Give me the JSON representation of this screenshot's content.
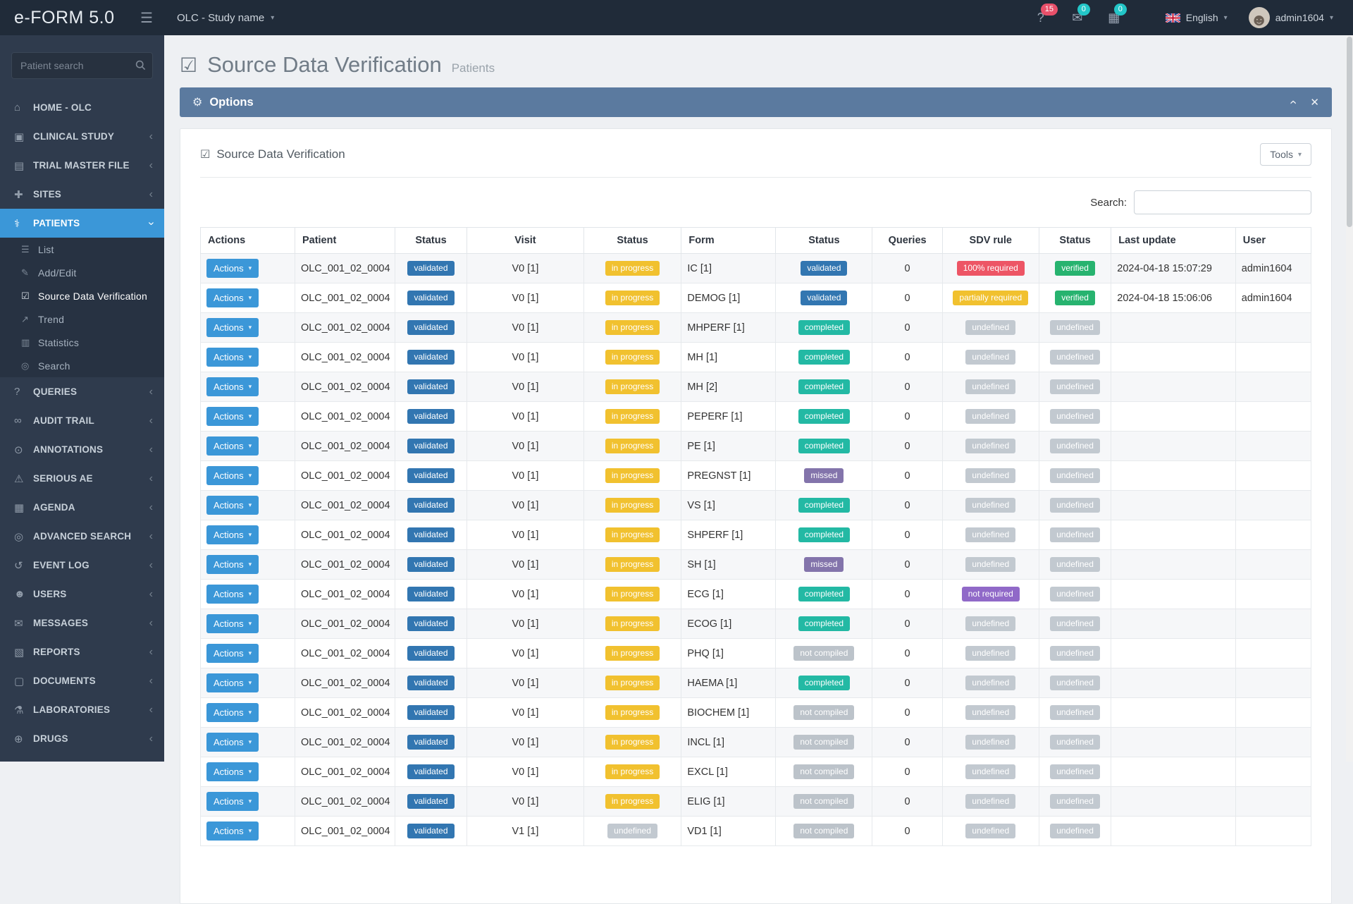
{
  "topbar": {
    "logo": "e-FORM 5.0",
    "study": "OLC - Study name",
    "language": "English",
    "username": "admin1604",
    "notifications": [
      {
        "icon": "?",
        "icon_name": "help-icon",
        "count": "15",
        "badge_style": "red"
      },
      {
        "icon": "✉",
        "icon_name": "messages-icon",
        "count": "0",
        "badge_style": "teal"
      },
      {
        "icon": "▦",
        "icon_name": "calendar-icon",
        "count": "0",
        "badge_style": "teal"
      }
    ]
  },
  "sidebar": {
    "search_placeholder": "Patient search",
    "items": [
      {
        "label": "HOME - OLC",
        "icon": "⌂",
        "icon_name": "home-icon",
        "name": "sidebar-item-home-olc",
        "chev": "none"
      },
      {
        "label": "CLINICAL STUDY",
        "icon": "▣",
        "icon_name": "clinical-study-icon",
        "name": "sidebar-item-clinical-study",
        "chev": "left"
      },
      {
        "label": "TRIAL MASTER FILE",
        "icon": "▤",
        "icon_name": "folder-icon",
        "name": "sidebar-item-trial-master-file",
        "chev": "left"
      },
      {
        "label": "SITES",
        "icon": "✚",
        "icon_name": "hospital-icon",
        "name": "sidebar-item-sites",
        "chev": "left"
      },
      {
        "label": "PATIENTS",
        "icon": "⚕",
        "icon_name": "patients-icon",
        "name": "sidebar-item-patients",
        "chev": "down",
        "state": "active",
        "sub": [
          {
            "label": "List",
            "icon": "☰",
            "icon_name": "list-icon",
            "name": "sidebar-subitem-list"
          },
          {
            "label": "Add/Edit",
            "icon": "✎",
            "icon_name": "pencil-icon",
            "name": "sidebar-subitem-add-edit"
          },
          {
            "label": "Source Data Verification",
            "icon": "☑",
            "icon_name": "check-square-icon",
            "name": "sidebar-subitem-source-data-verification",
            "state": "active"
          },
          {
            "label": "Trend",
            "icon": "↗",
            "icon_name": "trend-icon",
            "name": "sidebar-subitem-trend"
          },
          {
            "label": "Statistics",
            "icon": "▥",
            "icon_name": "bar-chart-icon",
            "name": "sidebar-subitem-statistics"
          },
          {
            "label": "Search",
            "icon": "◎",
            "icon_name": "search-icon",
            "name": "sidebar-subitem-search"
          }
        ]
      },
      {
        "label": "QUERIES",
        "icon": "?",
        "icon_name": "question-icon",
        "name": "sidebar-item-queries",
        "chev": "left"
      },
      {
        "label": "AUDIT TRAIL",
        "icon": "∞",
        "icon_name": "link-icon",
        "name": "sidebar-item-audit-trail",
        "chev": "left"
      },
      {
        "label": "ANNOTATIONS",
        "icon": "⊙",
        "icon_name": "comment-icon",
        "name": "sidebar-item-annotations",
        "chev": "left"
      },
      {
        "label": "SERIOUS AE",
        "icon": "⚠",
        "icon_name": "warning-icon",
        "name": "sidebar-item-serious-ae",
        "chev": "left"
      },
      {
        "label": "AGENDA",
        "icon": "▦",
        "icon_name": "calendar-icon",
        "name": "sidebar-item-agenda",
        "chev": "left"
      },
      {
        "label": "ADVANCED SEARCH",
        "icon": "◎",
        "icon_name": "search-icon",
        "name": "sidebar-item-advanced-search",
        "chev": "left"
      },
      {
        "label": "EVENT LOG",
        "icon": "↺",
        "icon_name": "history-icon",
        "name": "sidebar-item-event-log",
        "chev": "left"
      },
      {
        "label": "USERS",
        "icon": "☻",
        "icon_name": "user-icon",
        "name": "sidebar-item-users",
        "chev": "left"
      },
      {
        "label": "MESSAGES",
        "icon": "✉",
        "icon_name": "envelope-icon",
        "name": "sidebar-item-messages",
        "chev": "left"
      },
      {
        "label": "REPORTS",
        "icon": "▧",
        "icon_name": "report-icon",
        "name": "sidebar-item-reports",
        "chev": "left"
      },
      {
        "label": "DOCUMENTS",
        "icon": "▢",
        "icon_name": "document-icon",
        "name": "sidebar-item-documents",
        "chev": "left"
      },
      {
        "label": "LABORATORIES",
        "icon": "⚗",
        "icon_name": "flask-icon",
        "name": "sidebar-item-laboratories",
        "chev": "left"
      },
      {
        "label": "DRUGS",
        "icon": "⊕",
        "icon_name": "pills-icon",
        "name": "sidebar-item-drugs",
        "chev": "left"
      }
    ]
  },
  "page": {
    "title": "Source Data Verification",
    "subtitle": "Patients",
    "options_label": "Options"
  },
  "panel": {
    "title": "Source Data Verification",
    "tools_label": "Tools",
    "search_label": "Search:"
  },
  "table": {
    "actions_label": "Actions",
    "headers": [
      "Actions",
      "Patient",
      "Status",
      "Visit",
      "Status",
      "Form",
      "Status",
      "Queries",
      "SDV rule",
      "Status",
      "Last update",
      "User"
    ],
    "rows": [
      {
        "patient": "OLC_001_02_0004",
        "patient_status": "validated",
        "visit": "V0 [1]",
        "visit_status": "in progress",
        "form": "IC [1]",
        "form_status": "validated",
        "queries": "0",
        "sdv_rule": "100% required",
        "sdv_status": "verified",
        "last_update": "2024-04-18 15:07:29",
        "user": "admin1604"
      },
      {
        "patient": "OLC_001_02_0004",
        "patient_status": "validated",
        "visit": "V0 [1]",
        "visit_status": "in progress",
        "form": "DEMOG [1]",
        "form_status": "validated",
        "queries": "0",
        "sdv_rule": "partially required",
        "sdv_status": "verified",
        "last_update": "2024-04-18 15:06:06",
        "user": "admin1604"
      },
      {
        "patient": "OLC_001_02_0004",
        "patient_status": "validated",
        "visit": "V0 [1]",
        "visit_status": "in progress",
        "form": "MHPERF [1]",
        "form_status": "completed",
        "queries": "0",
        "sdv_rule": "undefined",
        "sdv_status": "undefined",
        "last_update": "",
        "user": ""
      },
      {
        "patient": "OLC_001_02_0004",
        "patient_status": "validated",
        "visit": "V0 [1]",
        "visit_status": "in progress",
        "form": "MH [1]",
        "form_status": "completed",
        "queries": "0",
        "sdv_rule": "undefined",
        "sdv_status": "undefined",
        "last_update": "",
        "user": ""
      },
      {
        "patient": "OLC_001_02_0004",
        "patient_status": "validated",
        "visit": "V0 [1]",
        "visit_status": "in progress",
        "form": "MH [2]",
        "form_status": "completed",
        "queries": "0",
        "sdv_rule": "undefined",
        "sdv_status": "undefined",
        "last_update": "",
        "user": ""
      },
      {
        "patient": "OLC_001_02_0004",
        "patient_status": "validated",
        "visit": "V0 [1]",
        "visit_status": "in progress",
        "form": "PEPERF [1]",
        "form_status": "completed",
        "queries": "0",
        "sdv_rule": "undefined",
        "sdv_status": "undefined",
        "last_update": "",
        "user": ""
      },
      {
        "patient": "OLC_001_02_0004",
        "patient_status": "validated",
        "visit": "V0 [1]",
        "visit_status": "in progress",
        "form": "PE [1]",
        "form_status": "completed",
        "queries": "0",
        "sdv_rule": "undefined",
        "sdv_status": "undefined",
        "last_update": "",
        "user": ""
      },
      {
        "patient": "OLC_001_02_0004",
        "patient_status": "validated",
        "visit": "V0 [1]",
        "visit_status": "in progress",
        "form": "PREGNST [1]",
        "form_status": "missed",
        "queries": "0",
        "sdv_rule": "undefined",
        "sdv_status": "undefined",
        "last_update": "",
        "user": ""
      },
      {
        "patient": "OLC_001_02_0004",
        "patient_status": "validated",
        "visit": "V0 [1]",
        "visit_status": "in progress",
        "form": "VS [1]",
        "form_status": "completed",
        "queries": "0",
        "sdv_rule": "undefined",
        "sdv_status": "undefined",
        "last_update": "",
        "user": ""
      },
      {
        "patient": "OLC_001_02_0004",
        "patient_status": "validated",
        "visit": "V0 [1]",
        "visit_status": "in progress",
        "form": "SHPERF [1]",
        "form_status": "completed",
        "queries": "0",
        "sdv_rule": "undefined",
        "sdv_status": "undefined",
        "last_update": "",
        "user": ""
      },
      {
        "patient": "OLC_001_02_0004",
        "patient_status": "validated",
        "visit": "V0 [1]",
        "visit_status": "in progress",
        "form": "SH [1]",
        "form_status": "missed",
        "queries": "0",
        "sdv_rule": "undefined",
        "sdv_status": "undefined",
        "last_update": "",
        "user": ""
      },
      {
        "patient": "OLC_001_02_0004",
        "patient_status": "validated",
        "visit": "V0 [1]",
        "visit_status": "in progress",
        "form": "ECG [1]",
        "form_status": "completed",
        "queries": "0",
        "sdv_rule": "not required",
        "sdv_status": "undefined",
        "last_update": "",
        "user": ""
      },
      {
        "patient": "OLC_001_02_0004",
        "patient_status": "validated",
        "visit": "V0 [1]",
        "visit_status": "in progress",
        "form": "ECOG [1]",
        "form_status": "completed",
        "queries": "0",
        "sdv_rule": "undefined",
        "sdv_status": "undefined",
        "last_update": "",
        "user": ""
      },
      {
        "patient": "OLC_001_02_0004",
        "patient_status": "validated",
        "visit": "V0 [1]",
        "visit_status": "in progress",
        "form": "PHQ [1]",
        "form_status": "not compiled",
        "queries": "0",
        "sdv_rule": "undefined",
        "sdv_status": "undefined",
        "last_update": "",
        "user": ""
      },
      {
        "patient": "OLC_001_02_0004",
        "patient_status": "validated",
        "visit": "V0 [1]",
        "visit_status": "in progress",
        "form": "HAEMA [1]",
        "form_status": "completed",
        "queries": "0",
        "sdv_rule": "undefined",
        "sdv_status": "undefined",
        "last_update": "",
        "user": ""
      },
      {
        "patient": "OLC_001_02_0004",
        "patient_status": "validated",
        "visit": "V0 [1]",
        "visit_status": "in progress",
        "form": "BIOCHEM [1]",
        "form_status": "not compiled",
        "queries": "0",
        "sdv_rule": "undefined",
        "sdv_status": "undefined",
        "last_update": "",
        "user": ""
      },
      {
        "patient": "OLC_001_02_0004",
        "patient_status": "validated",
        "visit": "V0 [1]",
        "visit_status": "in progress",
        "form": "INCL [1]",
        "form_status": "not compiled",
        "queries": "0",
        "sdv_rule": "undefined",
        "sdv_status": "undefined",
        "last_update": "",
        "user": ""
      },
      {
        "patient": "OLC_001_02_0004",
        "patient_status": "validated",
        "visit": "V0 [1]",
        "visit_status": "in progress",
        "form": "EXCL [1]",
        "form_status": "not compiled",
        "queries": "0",
        "sdv_rule": "undefined",
        "sdv_status": "undefined",
        "last_update": "",
        "user": ""
      },
      {
        "patient": "OLC_001_02_0004",
        "patient_status": "validated",
        "visit": "V0 [1]",
        "visit_status": "in progress",
        "form": "ELIG [1]",
        "form_status": "not compiled",
        "queries": "0",
        "sdv_rule": "undefined",
        "sdv_status": "undefined",
        "last_update": "",
        "user": ""
      },
      {
        "patient": "OLC_001_02_0004",
        "patient_status": "validated",
        "visit": "V1 [1]",
        "visit_status": "undefined",
        "form": "VD1 [1]",
        "form_status": "not compiled",
        "queries": "0",
        "sdv_rule": "undefined",
        "sdv_status": "undefined",
        "last_update": "",
        "user": ""
      }
    ]
  },
  "colors": {
    "accent_blue": "#3b97d8",
    "options_bar": "#5b7a9f",
    "badge_validated": "#3276b1",
    "badge_in_progress": "#f1c12f",
    "badge_completed": "#23b9a4",
    "badge_missed": "#8374ab",
    "badge_not_compiled": "#bcc3ca",
    "badge_100_required": "#ed5565",
    "badge_partially_required": "#f1c12f",
    "badge_verified": "#27b36f",
    "badge_undefined": "#c2c9d0",
    "badge_not_required": "#9069c8",
    "count_red": "#e8506a",
    "count_teal": "#23c6c8"
  }
}
